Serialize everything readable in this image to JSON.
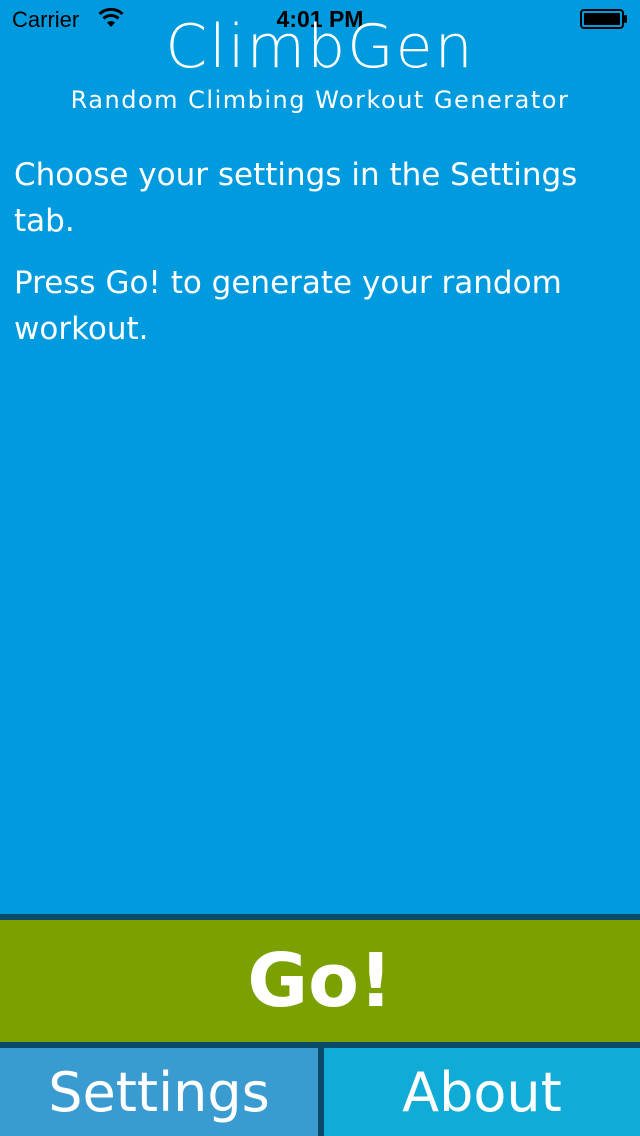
{
  "status_bar": {
    "carrier": "Carrier",
    "time": "4:01 PM",
    "wifi_icon": "wifi-icon",
    "battery_icon": "battery-icon"
  },
  "header": {
    "title": "ClimbGen",
    "subtitle": "Random Climbing Workout Generator"
  },
  "instructions": {
    "line1": "Choose your settings in the Settings tab.",
    "line2": "Press Go! to generate your random workout."
  },
  "actions": {
    "go_label": "Go!"
  },
  "tabs": [
    {
      "label": "Settings"
    },
    {
      "label": "About"
    }
  ],
  "colors": {
    "background": "#009ADF",
    "go_button": "#7BA100",
    "tab_settings": "#3A9BD0",
    "tab_about": "#10ABD6",
    "divider": "#0A4A68"
  }
}
